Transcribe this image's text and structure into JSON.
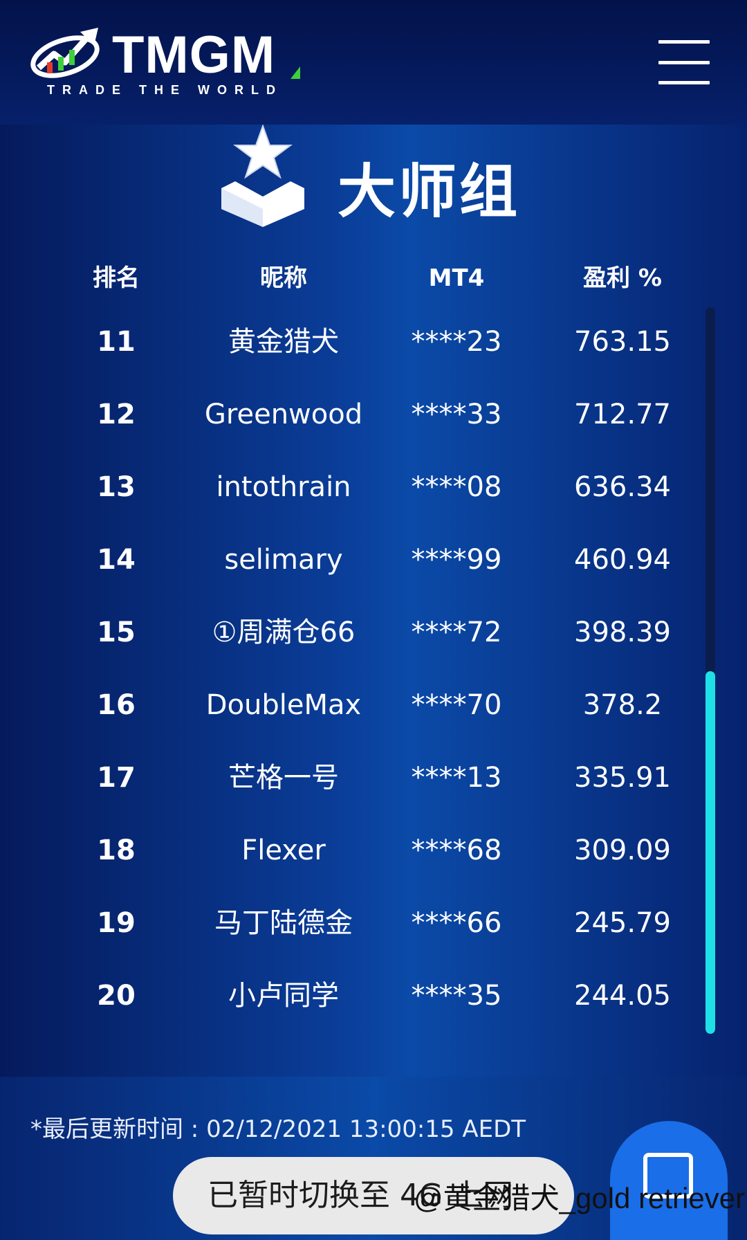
{
  "brand": {
    "name": "TMGM",
    "tagline": "TRADE THE WORLD",
    "colors": {
      "green": "#3ecf3a",
      "red": "#e23b2e",
      "white": "#ffffff"
    }
  },
  "header": {
    "menu_icon": "hamburger-menu-icon"
  },
  "group": {
    "title": "大师组",
    "badge_icon": "star-chevron-badge-icon"
  },
  "table": {
    "headers": {
      "rank": "排名",
      "nickname": "昵称",
      "mt4": "MT4",
      "profit": "盈利 %"
    },
    "rows": [
      {
        "rank": "11",
        "nickname": "黄金猎犬",
        "mt4": "****23",
        "profit": "763.15"
      },
      {
        "rank": "12",
        "nickname": "Greenwood",
        "mt4": "****33",
        "profit": "712.77"
      },
      {
        "rank": "13",
        "nickname": "intothrain",
        "mt4": "****08",
        "profit": "636.34"
      },
      {
        "rank": "14",
        "nickname": "selimary",
        "mt4": "****99",
        "profit": "460.94"
      },
      {
        "rank": "15",
        "nickname": "①周满仓66",
        "mt4": "****72",
        "profit": "398.39"
      },
      {
        "rank": "16",
        "nickname": "DoubleMax",
        "mt4": "****70",
        "profit": "378.2"
      },
      {
        "rank": "17",
        "nickname": "芒格一号",
        "mt4": "****13",
        "profit": "335.91"
      },
      {
        "rank": "18",
        "nickname": "Flexer",
        "mt4": "****68",
        "profit": "309.09"
      },
      {
        "rank": "19",
        "nickname": "马丁陆德金",
        "mt4": "****66",
        "profit": "245.79"
      },
      {
        "rank": "20",
        "nickname": "小卢同学",
        "mt4": "****35",
        "profit": "244.05"
      }
    ],
    "scroll_position": 0.5
  },
  "footer": {
    "update_note": "*最后更新时间 : 02/12/2021 13:00:15 AEDT",
    "toast": "已暂时切换至 4G 上网",
    "fab_icon": "chat-window-icon",
    "watermark": "@黄金猎犬_gold retriever"
  },
  "colors": {
    "background": "#0a3d98",
    "header": "#03124a",
    "scroll_thumb": "#1ee0e6",
    "fab": "#1a6ee8",
    "toast": "#e9e9ea"
  }
}
